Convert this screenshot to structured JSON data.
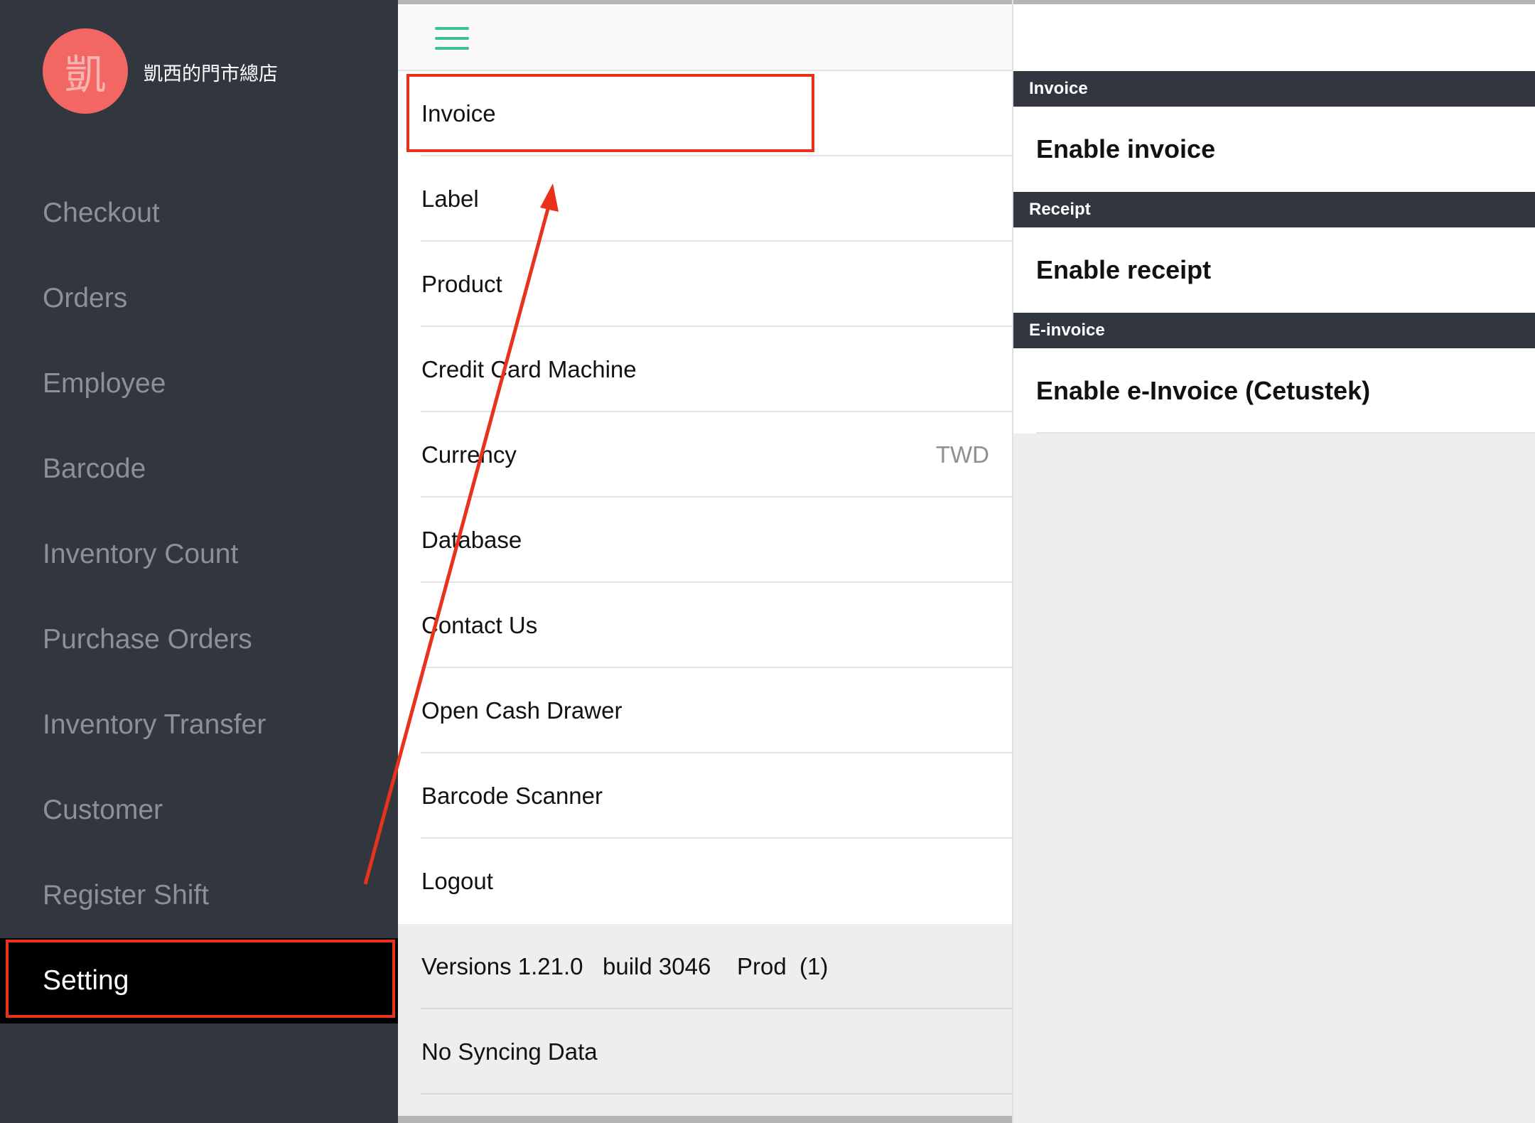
{
  "sidebar": {
    "logo_char": "凱",
    "store_name": "凱西的門市總店",
    "items": [
      {
        "label": "Checkout"
      },
      {
        "label": "Orders"
      },
      {
        "label": "Employee"
      },
      {
        "label": "Barcode"
      },
      {
        "label": "Inventory Count"
      },
      {
        "label": "Purchase Orders"
      },
      {
        "label": "Inventory Transfer"
      },
      {
        "label": "Customer"
      },
      {
        "label": "Register Shift"
      },
      {
        "label": "Setting",
        "active": true
      }
    ]
  },
  "settings_menu": {
    "icon": "hamburger-menu-icon",
    "items": [
      {
        "label": "Invoice"
      },
      {
        "label": "Label"
      },
      {
        "label": "Product"
      },
      {
        "label": "Credit Card Machine"
      },
      {
        "label": "Currency",
        "value": "TWD"
      },
      {
        "label": "Database"
      },
      {
        "label": "Contact Us"
      },
      {
        "label": "Open Cash Drawer"
      },
      {
        "label": "Barcode Scanner"
      },
      {
        "label": "Logout"
      }
    ],
    "version_text": "Versions 1.21.0   build 3046    Prod  (1)",
    "sync_text": "No Syncing Data"
  },
  "detail": {
    "sections": [
      {
        "header": "Invoice",
        "row": "Enable invoice"
      },
      {
        "header": "Receipt",
        "row": "Enable receipt"
      },
      {
        "header": "E-invoice",
        "row": "Enable e-Invoice (Cetustek)"
      }
    ]
  },
  "colors": {
    "sidebar_bg": "#32363f",
    "accent_green": "#3bbf98",
    "logo_red": "#f26763",
    "annotation_red": "#e8321c"
  }
}
